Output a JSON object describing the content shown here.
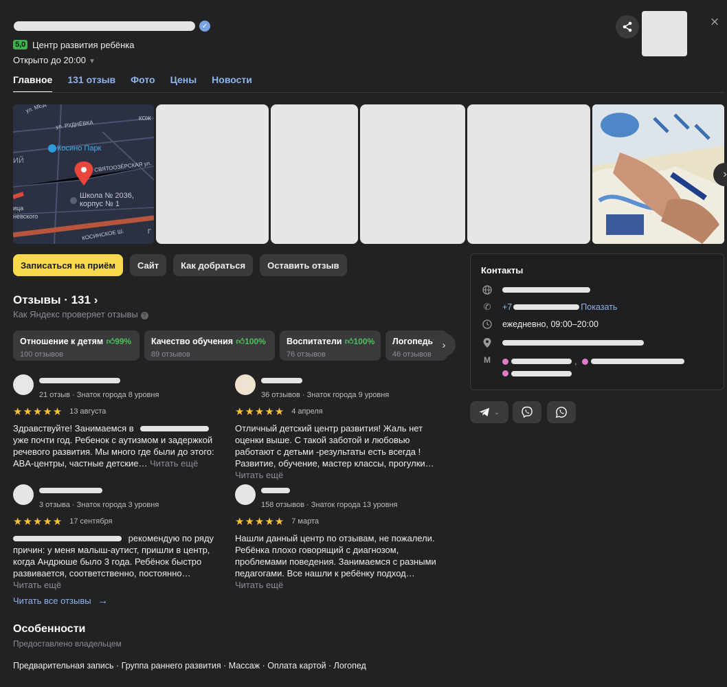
{
  "header": {
    "rating": "5,0",
    "category": "Центр развития ребёнка",
    "hours": "Открыто до 20:00",
    "verified_icon": "verified-icon",
    "share_icon": "share-icon",
    "close_icon": "close-icon"
  },
  "tabs": [
    {
      "label": "Главное"
    },
    {
      "label": "131 отзыв"
    },
    {
      "label": "Фото"
    },
    {
      "label": "Цены"
    },
    {
      "label": "Новости"
    }
  ],
  "map": {
    "streets": [
      "ул. РУДНЁВКА",
      "СВЯТООЗЁРСКАЯ ул.",
      "КОСИНСКОЕ Ш.",
      "ул. МЕД",
      "КОЖ"
    ],
    "park": "Косино Парк",
    "school_line1": "Школа № 2036,",
    "school_line2": "корпус № 1",
    "left_fragments": [
      "ИЙ",
      "ица",
      "невского"
    ],
    "bottom_fragment": "Г"
  },
  "actions": {
    "book": "Записаться на приём",
    "site": "Сайт",
    "route": "Как добраться",
    "review": "Оставить отзыв"
  },
  "reviews_section": {
    "title": "Отзывы · 131",
    "subtitle": "Как Яндекс проверяет отзывы",
    "aspects": [
      {
        "name": "Отношение к детям",
        "pct": "99%",
        "count": "100 отзывов"
      },
      {
        "name": "Качество обучения",
        "pct": "100%",
        "count": "89 отзывов"
      },
      {
        "name": "Воспитатели",
        "pct": "100%",
        "count": "76 отзывов"
      },
      {
        "name": "Логопеды",
        "pct": "",
        "count": "46 отзывов"
      }
    ],
    "read_more": "Читать ещё",
    "read_all": "Читать все отзывы"
  },
  "reviews": [
    {
      "meta": "21 отзыв · Знаток города 8 уровня",
      "stars": "★★★★★",
      "date": "13 августа",
      "text_a": "Здравствуйте! Занимаемся в",
      "text_b": "уже почти год. Ребенок с аутизмом и задержкой речевого развития. Мы много где были до этого: ABA-центры, частные детские…"
    },
    {
      "meta": "36 отзывов · Знаток города 9 уровня",
      "stars": "★★★★★",
      "date": "4 апреля",
      "text": "Отличный детский центр развития! Жаль нет оценки выше. С такой заботой и любовью работают с детьми -результаты есть всегда ! Развитие, обучение, мастер классы, прогулки…"
    },
    {
      "meta": "3 отзыва · Знаток города 3 уровня",
      "stars": "★★★★★",
      "date": "17 сентября",
      "text_a": "рекомендую по ряду",
      "text_b": "причин: у меня малыш-аутист, пришли в центр, когда Андрюше было 3 года. Ребёнок быстро развивается, соответственно, постоянно…"
    },
    {
      "meta": "158 отзывов · Знаток города 13 уровня",
      "stars": "★★★★★",
      "date": "7 марта",
      "text": "Нашли данный центр по отзывам, не пожалели. Ребёнка плохо говорящий с диагнозом, проблемами поведения. Занимаемся с разными педагогами. Все нашли к ребёнку подход…"
    }
  ],
  "features": {
    "title": "Особенности",
    "subtitle": "Предоставлено владельцем",
    "list": "Предварительная запись · Группа раннего развития · Массаж · Оплата картой · Логопед"
  },
  "contacts": {
    "title": "Контакты",
    "phone_prefix": "+7",
    "show": "Показать",
    "schedule": "ежедневно, 09:00–20:00",
    "metro_icon_label": "М"
  },
  "messengers": [
    "telegram-icon",
    "viber-icon",
    "whatsapp-icon"
  ],
  "colors": {
    "accent_yellow": "#f7d94a",
    "link_blue": "#8fb4ec",
    "rating_green": "#3bb54a",
    "metro_pink": "#e07bc8"
  }
}
